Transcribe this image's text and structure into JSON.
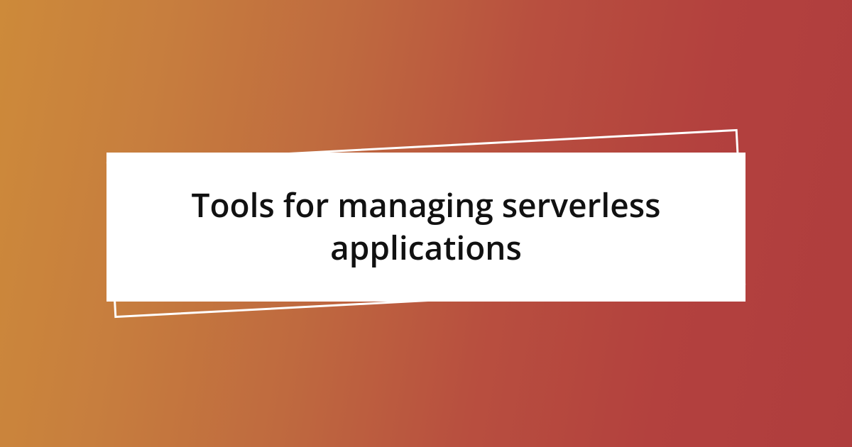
{
  "title": "Tools for managing serverless applications",
  "colors": {
    "gradient_start": "#cd8a3a",
    "gradient_end": "#af3d3d",
    "box_bg": "#ffffff",
    "text": "#111111",
    "outline": "#ffffff"
  }
}
